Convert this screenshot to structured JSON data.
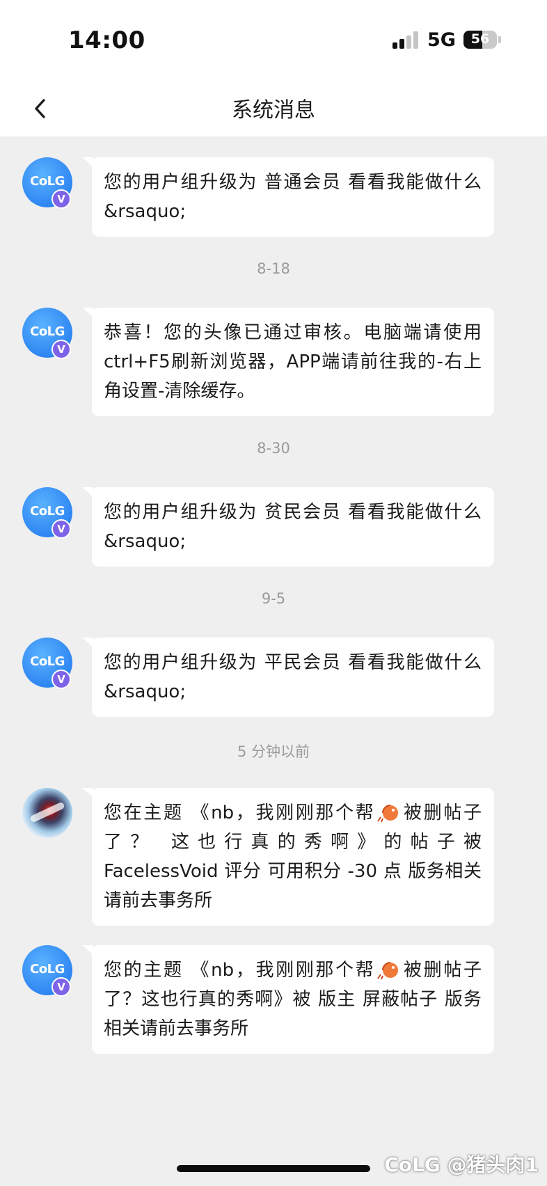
{
  "status_bar": {
    "time": "14:00",
    "network": "5G",
    "battery_percent": "56",
    "battery_level": 0.56,
    "signal_bars_active": 2,
    "signal_bars_total": 4
  },
  "nav": {
    "back_icon": "chevron-left-icon",
    "title": "系统消息"
  },
  "colors": {
    "background": "#efefef",
    "bubble": "#ffffff",
    "avatar_blue": "#2f86f2",
    "verified_badge": "#7c63e8",
    "timestamp": "#9a9a9a"
  },
  "avatars": {
    "colg_logo_text": "CoLG",
    "verified_mark": "V"
  },
  "messages": [
    {
      "avatar": "colg",
      "text": "您的用户组升级为  普通会员    看看我能做什么 &rsaquo;"
    },
    {
      "timestamp": "8-18"
    },
    {
      "avatar": "colg",
      "text": "恭喜！您的头像已通过审核。电脑端请使用ctrl+F5刷新浏览器，APP端请前往我的-右上角设置-清除缓存。"
    },
    {
      "timestamp": "8-30"
    },
    {
      "avatar": "colg",
      "text": "您的用户组升级为  贫民会员    看看我能做什么 &rsaquo;"
    },
    {
      "timestamp": "9-5"
    },
    {
      "avatar": "colg",
      "text": "您的用户组升级为  平民会员    看看我能做什么 &rsaquo;"
    },
    {
      "timestamp": "5 分钟以前"
    },
    {
      "avatar": "user",
      "text_before": "您在主题 《nb，我刚刚那个帮",
      "emoji": "shrimp-emoji",
      "text_after": "被删帖子了？ 这也行真的秀啊》的帖子被 FacelessVoid 评分 可用积分 -30 点 版务相关请前去事务所"
    },
    {
      "avatar": "colg",
      "text_before": "您的主题 《nb，我刚刚那个帮",
      "emoji": "shrimp-emoji",
      "text_after": "被删帖子了？这也行真的秀啊》被 版主 屏蔽帖子 版务相关请前去事务所"
    }
  ],
  "watermark": "CoLG @猪头肉1"
}
